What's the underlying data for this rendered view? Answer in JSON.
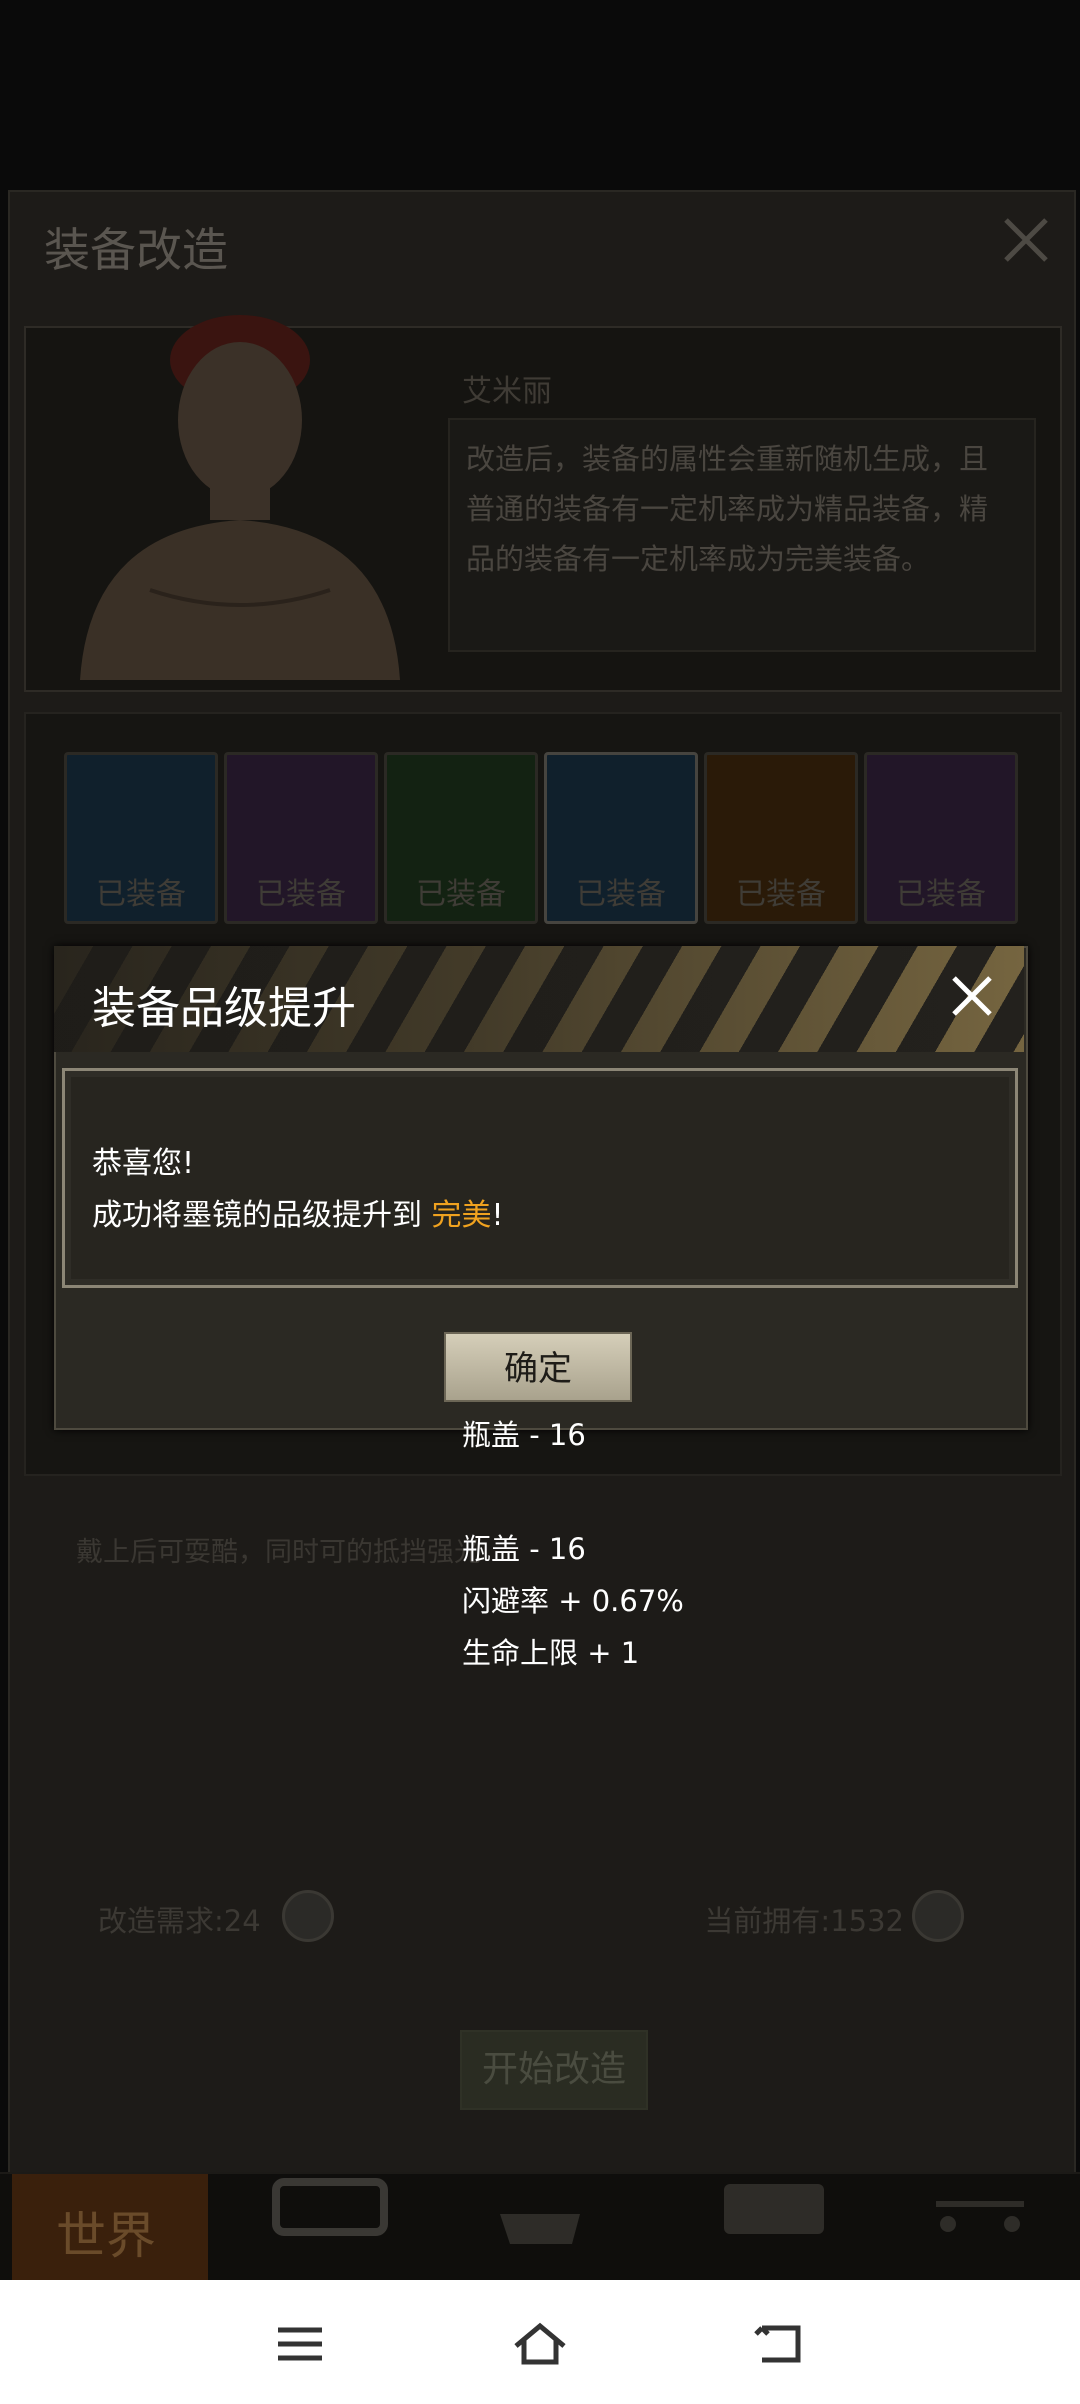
{
  "background": {
    "title": "装备改造",
    "character_name": "艾米丽",
    "description": "改造后，装备的属性会重新随机生成，且普通的装备有一定机率成为精品装备，精品的装备有一定机率成为完美装备。",
    "slots": [
      {
        "label": "已装备",
        "color": "#10202c"
      },
      {
        "label": "已装备",
        "color": "#221628"
      },
      {
        "label": "已装备",
        "color": "#132212"
      },
      {
        "label": "已装备",
        "color": "#10202c"
      },
      {
        "label": "已装备",
        "color": "#2a1a08"
      },
      {
        "label": "已装备",
        "color": "#221628"
      }
    ],
    "hint": "戴上后可耍酷，同时可的抵挡强光",
    "cost_label": "改造需求:24",
    "owned_label": "当前拥有:1532",
    "start_button": "开始改造",
    "world_tab": "世界"
  },
  "dialog": {
    "title": "装备品级提升",
    "line1": "恭喜您!",
    "line2_prefix": "成功将墨镜的品级提升到 ",
    "quality": "完美",
    "line2_suffix": "!",
    "confirm": "确定"
  },
  "stats": {
    "cap1": "瓶盖 - 16",
    "cap2": "瓶盖 - 16",
    "dodge": "闪避率 + 0.67%",
    "hp": "生命上限 + 1"
  },
  "colors": {
    "accent_gold": "#f0a21f",
    "stripe": "#a48c55"
  }
}
